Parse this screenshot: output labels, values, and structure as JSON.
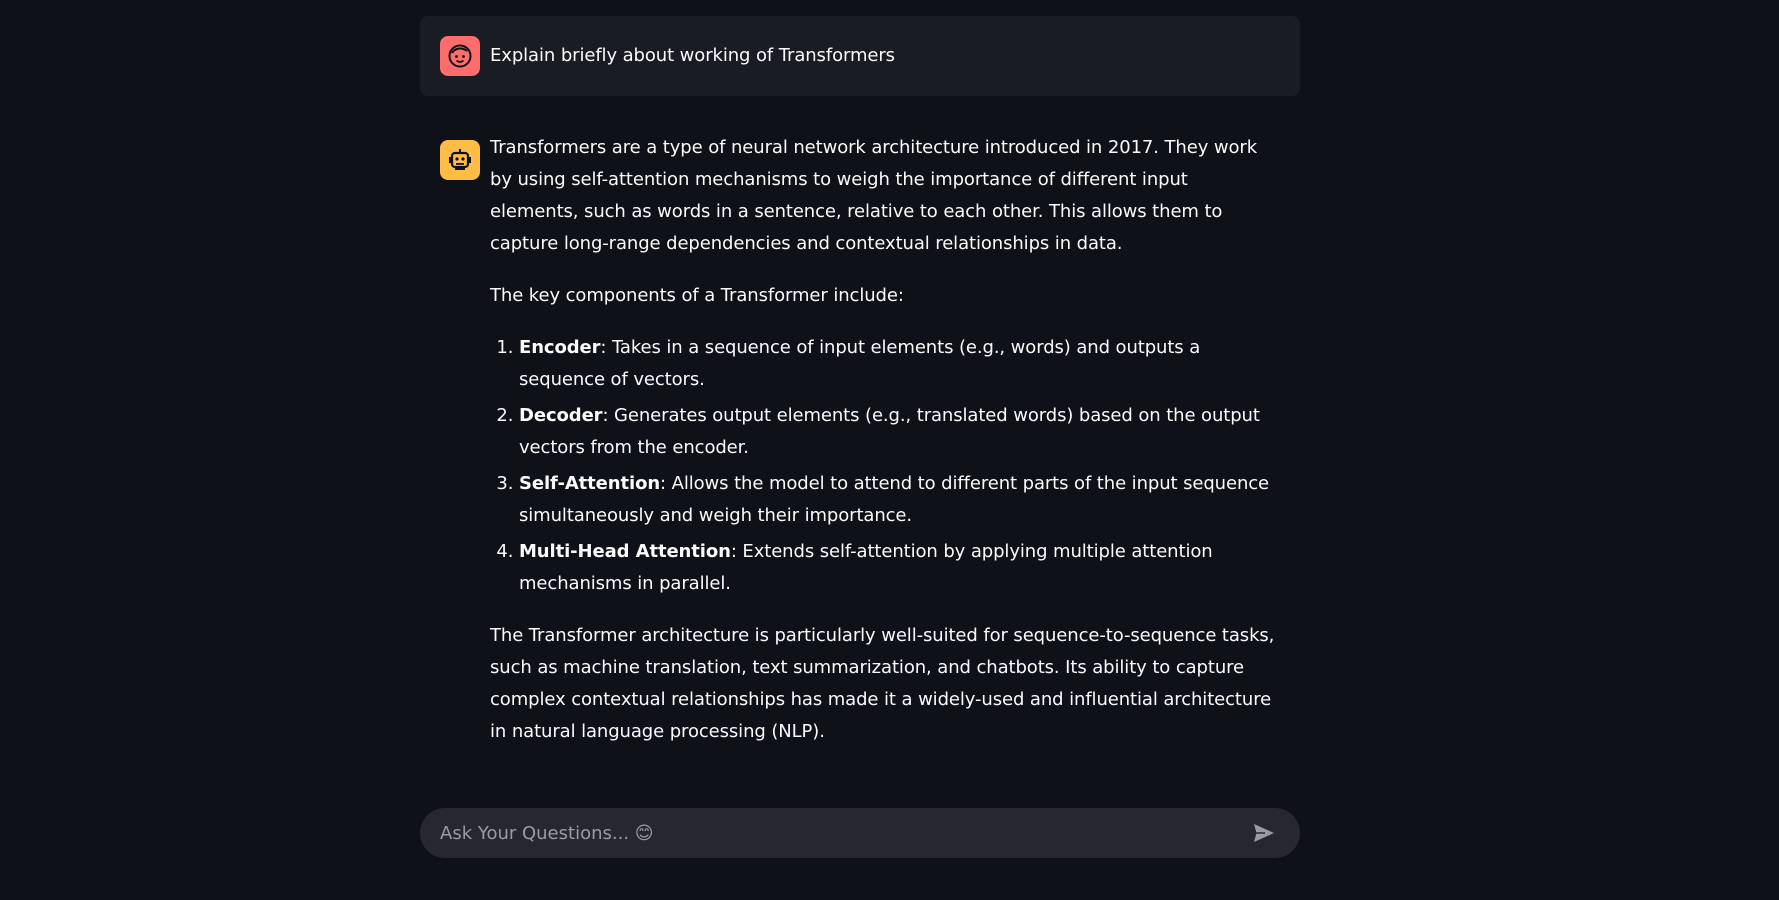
{
  "chat": {
    "user_message": "Explain briefly about working of Transformers",
    "assistant_message": {
      "paragraph_1": "Transformers are a type of neural network architecture introduced in 2017. They work by using self-attention mechanisms to weigh the importance of different input elements, such as words in a sentence, relative to each other. This allows them to capture long-range dependencies and contextual relationships in data.",
      "paragraph_2": "The key components of a Transformer include:",
      "list": [
        {
          "term": "Encoder",
          "text": ": Takes in a sequence of input elements (e.g., words) and outputs a sequence of vectors."
        },
        {
          "term": "Decoder",
          "text": ": Generates output elements (e.g., translated words) based on the output vectors from the encoder."
        },
        {
          "term": "Self-Attention",
          "text": ": Allows the model to attend to different parts of the input sequence simultaneously and weigh their importance."
        },
        {
          "term": "Multi-Head Attention",
          "text": ": Extends self-attention by applying multiple attention mechanisms in parallel."
        }
      ],
      "paragraph_3": "The Transformer architecture is particularly well-suited for sequence-to-sequence tasks, such as machine translation, text summarization, and chatbots. Its ability to capture complex contextual relationships has made it a widely-used and influential architecture in natural language processing (NLP)."
    }
  },
  "input": {
    "placeholder": "Ask Your Questions... 😊"
  },
  "icons": {
    "user_avatar": "user-face-icon",
    "assistant_avatar": "robot-icon",
    "send": "send-arrow-icon"
  },
  "colors": {
    "background": "#0e1117",
    "user_avatar_bg": "#ff6c6c",
    "bot_avatar_bg": "#ffbd45",
    "user_bubble_bg": "#1a1c24",
    "input_bg": "#262730"
  }
}
